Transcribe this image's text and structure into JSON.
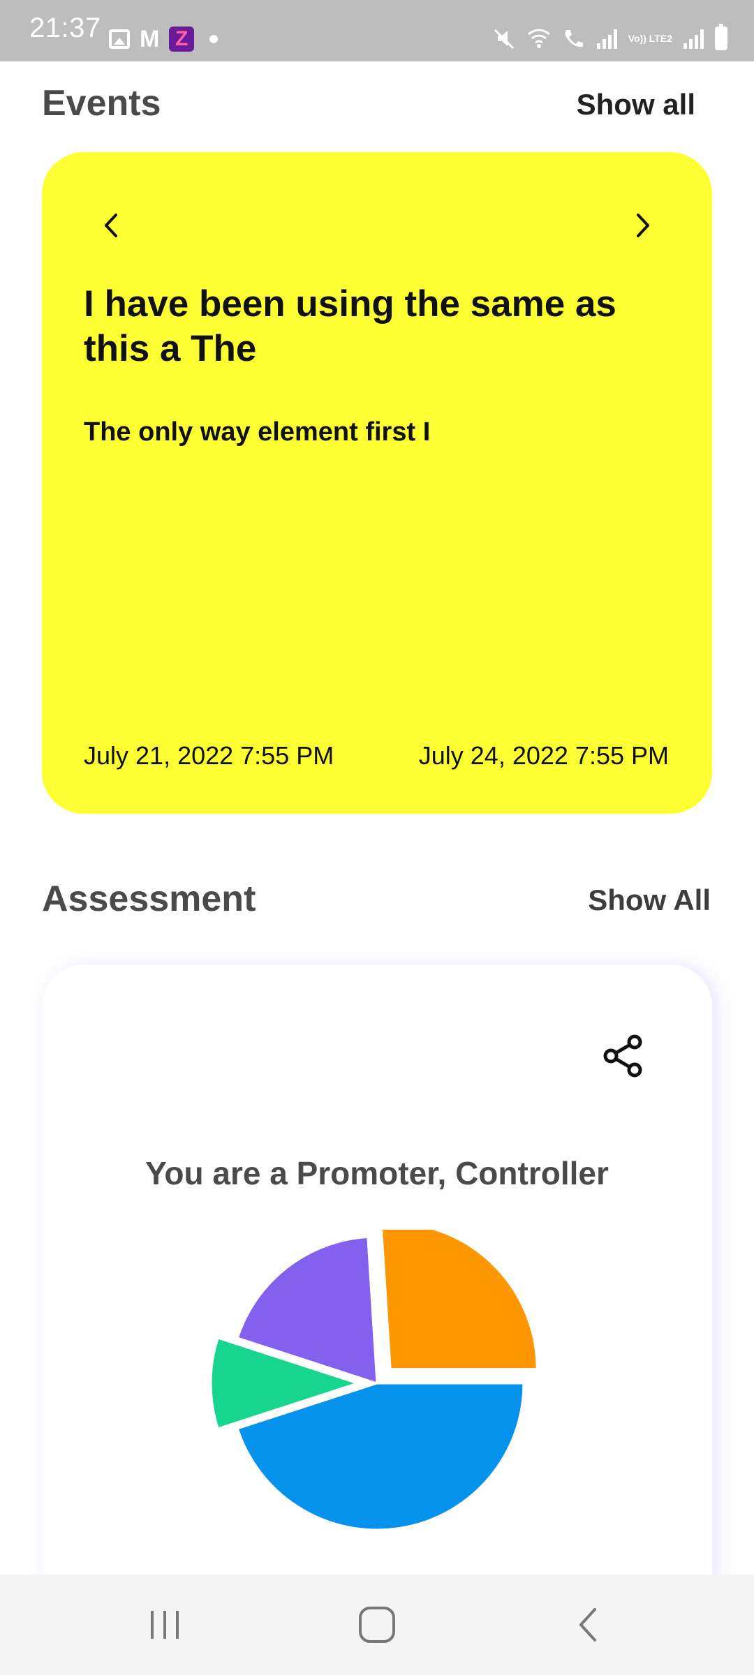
{
  "status_bar": {
    "time": "21:37",
    "icons": [
      "gallery-icon",
      "gmail-icon",
      "zee5-icon",
      "notification-dot-icon",
      "mute-icon",
      "wifi-icon",
      "volte-call-icon",
      "signal-icon",
      "signal-icon",
      "battery-icon"
    ],
    "gmail_glyph": "M",
    "app_glyph": "Z",
    "lte_text": "Vo)) LTE2"
  },
  "events": {
    "title": "Events",
    "show_all_label": "Show all",
    "card": {
      "background": "#fdff33",
      "title": "I have been using the same as this a The",
      "description": "The only way element first I",
      "start_date": "July 21, 2022 7:55 PM",
      "end_date": "July 24, 2022 7:55 PM",
      "prev_icon": "chevron-left-icon",
      "next_icon": "chevron-right-icon"
    }
  },
  "assessment": {
    "title": "Assessment",
    "show_all_label": "Show All",
    "share_icon": "share-icon",
    "result_text": "You are a Promoter, Controller"
  },
  "chart_data": {
    "type": "pie",
    "title": "",
    "slices": [
      {
        "value": 45,
        "color": "#0592ed",
        "exploded": false
      },
      {
        "value": 10,
        "color": "#16d68f",
        "exploded": true
      },
      {
        "value": 19,
        "color": "#8360ee",
        "exploded": false
      },
      {
        "value": 26,
        "color": "#fe9600",
        "exploded": true
      }
    ]
  },
  "nav_bar": {
    "icons": [
      "recent-apps-icon",
      "home-icon",
      "back-icon"
    ]
  }
}
